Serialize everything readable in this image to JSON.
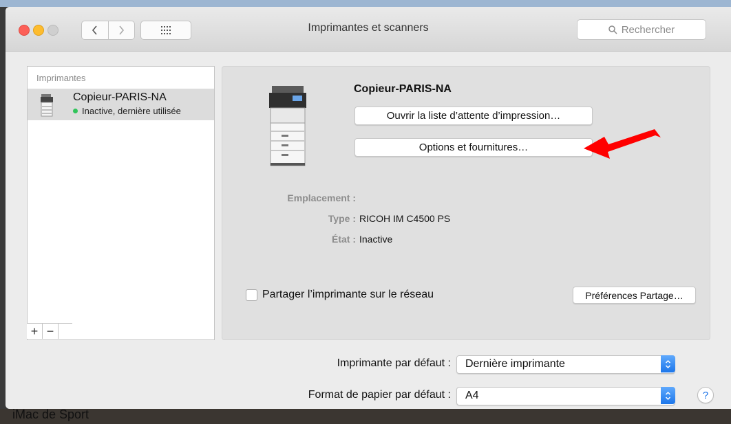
{
  "window": {
    "title": "Imprimantes et scanners"
  },
  "search": {
    "placeholder": "Rechercher"
  },
  "printers_list": {
    "header": "Imprimantes",
    "items": [
      {
        "name": "Copieur-PARIS-NA",
        "status": "Inactive, dernière utilisée",
        "status_color": "#30c45a"
      }
    ]
  },
  "detail": {
    "printer_name": "Copieur-PARIS-NA",
    "open_queue_label": "Ouvrir la liste d’attente d’impression…",
    "options_label": "Options et fournitures…",
    "location_label": "Emplacement :",
    "location_value": "",
    "type_label": "Type :",
    "type_value": "RICOH IM C4500 PS",
    "state_label": "État :",
    "state_value": "Inactive",
    "share_label": "Partager l’imprimante sur le réseau",
    "share_checked": false,
    "share_prefs_label": "Préférences Partage…"
  },
  "defaults": {
    "printer_label": "Imprimante par défaut :",
    "printer_value": "Dernière imprimante",
    "paper_label": "Format de papier par défaut :",
    "paper_value": "A4"
  },
  "list_controls": {
    "add": "+",
    "remove": "−"
  },
  "help_label": "?",
  "background_text": "iMac de Sport",
  "annotation": {
    "arrow_color": "#ff0000"
  }
}
